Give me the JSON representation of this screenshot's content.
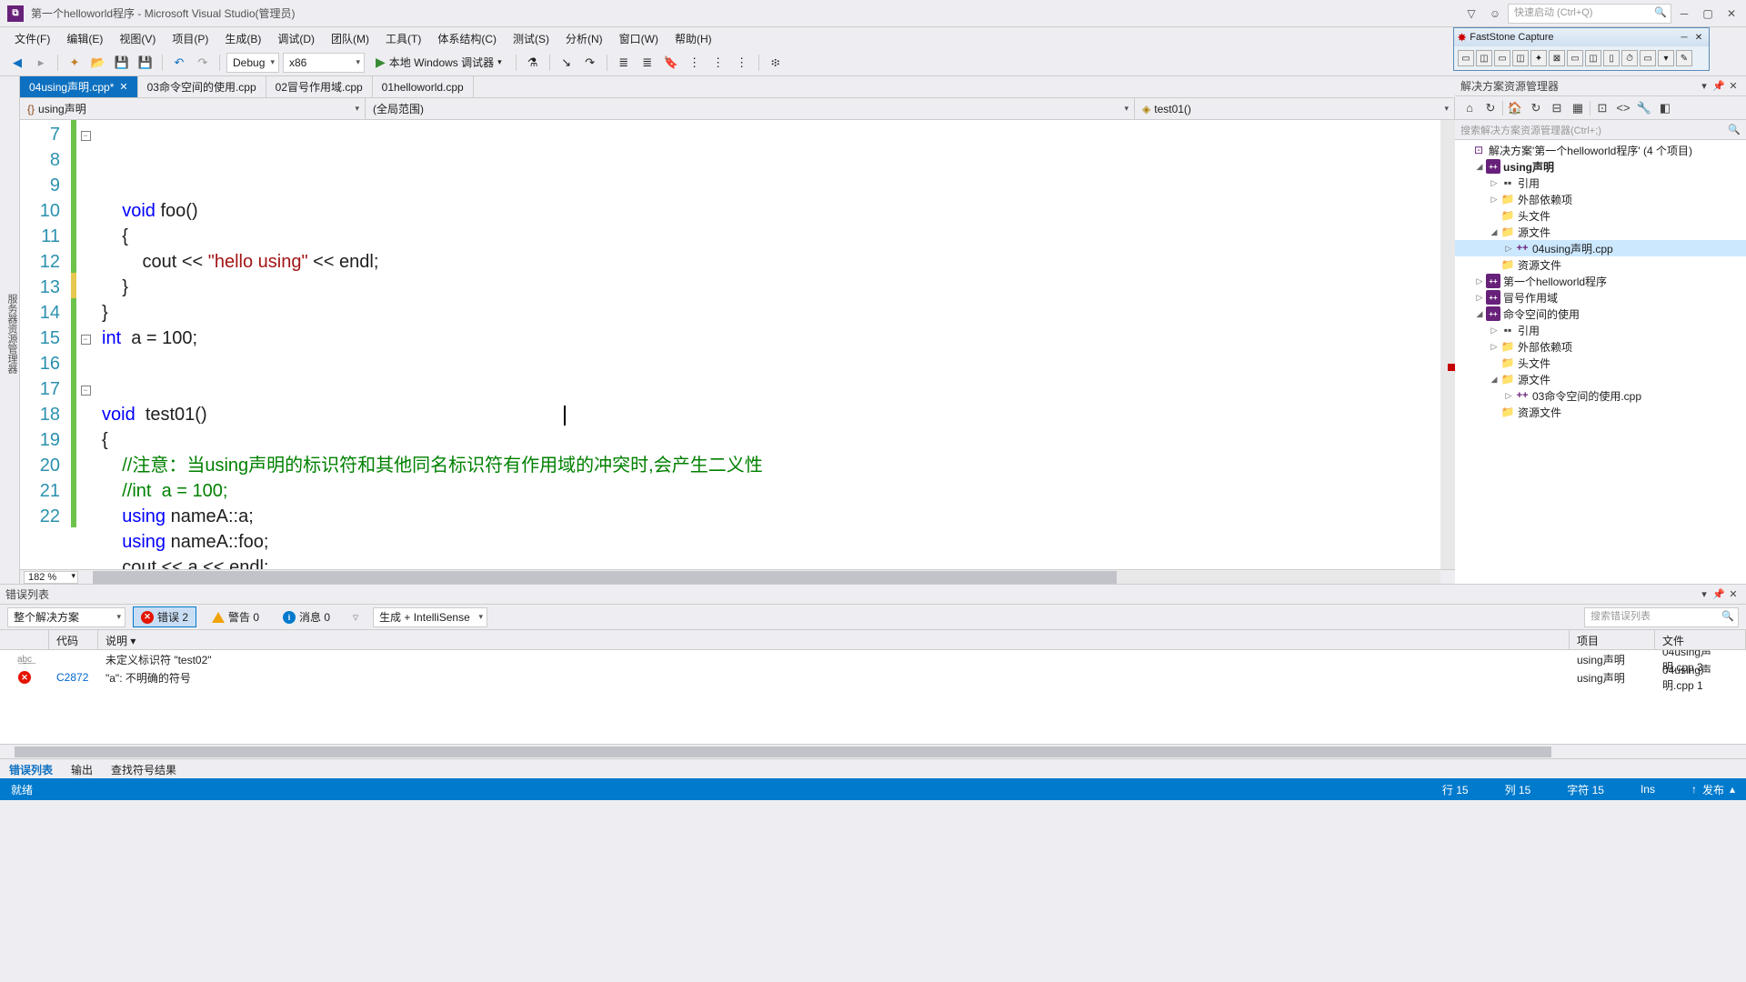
{
  "title": "第一个helloworld程序 - Microsoft Visual Studio(管理员)",
  "quickLaunch": "快速启动 (Ctrl+Q)",
  "menu": [
    "文件(F)",
    "编辑(E)",
    "视图(V)",
    "项目(P)",
    "生成(B)",
    "调试(D)",
    "团队(M)",
    "工具(T)",
    "体系结构(C)",
    "测试(S)",
    "分析(N)",
    "窗口(W)",
    "帮助(H)"
  ],
  "toolbar": {
    "config": "Debug",
    "platform": "x86",
    "startLabel": "本地 Windows 调试器"
  },
  "tabs": [
    {
      "label": "04using声明.cpp*",
      "active": true,
      "closable": true
    },
    {
      "label": "03命令空间的使用.cpp",
      "active": false
    },
    {
      "label": "02冒号作用域.cpp",
      "active": false
    },
    {
      "label": "01helloworld.cpp",
      "active": false
    }
  ],
  "navBar": {
    "left": "using声明",
    "middle": "(全局范围)",
    "right": "test01()"
  },
  "code": {
    "lines": [
      {
        "n": 7,
        "fold": "-",
        "html": "    <span class='kw'>void</span> foo()"
      },
      {
        "n": 8,
        "html": "    {"
      },
      {
        "n": 9,
        "html": "        cout &lt;&lt; <span class='str'>\"hello using\"</span> &lt;&lt; endl;"
      },
      {
        "n": 10,
        "html": "    }"
      },
      {
        "n": 11,
        "html": "}"
      },
      {
        "n": 12,
        "html": "<span class='kw'>int</span>  a = 100;"
      },
      {
        "n": 13,
        "mod": "yellow",
        "html": ""
      },
      {
        "n": 14,
        "html": ""
      },
      {
        "n": 15,
        "fold": "-",
        "html": "<span class='kw'>void</span>  test01()"
      },
      {
        "n": 16,
        "html": "{"
      },
      {
        "n": 17,
        "fold": "-",
        "html": "    <span class='cmt'>//注意：当using声明的标识符和其他同名标识符有作用域的冲突时,会产生二义性</span>"
      },
      {
        "n": 18,
        "html": "    <span class='cmt'>//int  a = 100;</span>"
      },
      {
        "n": 19,
        "html": "    <span class='kw'>using</span> nameA::a;"
      },
      {
        "n": 20,
        "html": "    <span class='kw'>using</span> nameA::foo;"
      },
      {
        "n": 21,
        "html": "    cout &lt;&lt; a &lt;&lt; endl;"
      },
      {
        "n": 22,
        "html": "    cout &lt;&lt; a &lt;&lt; endl;"
      }
    ],
    "zoom": "182 %"
  },
  "solutionExplorer": {
    "title": "解决方案资源管理器",
    "searchPlaceholder": "搜索解决方案资源管理器(Ctrl+;)",
    "root": "解决方案'第一个helloworld程序' (4 个项目)",
    "projects": [
      {
        "name": "using声明",
        "expanded": true,
        "bold": true,
        "children": [
          {
            "name": "引用",
            "icon": "ref",
            "arrow": "▷"
          },
          {
            "name": "外部依赖项",
            "icon": "folder",
            "arrow": "▷"
          },
          {
            "name": "头文件",
            "icon": "folder"
          },
          {
            "name": "源文件",
            "icon": "folder",
            "expanded": true,
            "children": [
              {
                "name": "04using声明.cpp",
                "icon": "cpp",
                "selected": true,
                "arrow": "▷"
              }
            ]
          },
          {
            "name": "资源文件",
            "icon": "folder"
          }
        ]
      },
      {
        "name": "第一个helloworld程序",
        "arrow": "▷"
      },
      {
        "name": "冒号作用域",
        "arrow": "▷"
      },
      {
        "name": "命令空间的使用",
        "expanded": true,
        "children": [
          {
            "name": "引用",
            "icon": "ref",
            "arrow": "▷"
          },
          {
            "name": "外部依赖项",
            "icon": "folder",
            "arrow": "▷"
          },
          {
            "name": "头文件",
            "icon": "folder"
          },
          {
            "name": "源文件",
            "icon": "folder",
            "expanded": true,
            "children": [
              {
                "name": "03命令空间的使用.cpp",
                "icon": "cpp",
                "arrow": "▷"
              }
            ]
          },
          {
            "name": "资源文件",
            "icon": "folder"
          }
        ]
      }
    ]
  },
  "errorList": {
    "title": "错误列表",
    "scope": "整个解决方案",
    "errCount": "错误 2",
    "warnCount": "警告 0",
    "infoCount": "消息 0",
    "buildFilter": "生成 + IntelliSense",
    "searchPlaceholder": "搜索错误列表",
    "columns": [
      "",
      "代码",
      "说明",
      "项目",
      "文件"
    ],
    "rows": [
      {
        "icon": "abc",
        "code": "",
        "desc": "未定义标识符 \"test02\"",
        "proj": "using声明",
        "file": "04using声明.cpp 3"
      },
      {
        "icon": "err",
        "code": "C2872",
        "desc": "\"a\": 不明确的符号",
        "proj": "using声明",
        "file": "04using声明.cpp 1"
      }
    ]
  },
  "outputTabs": [
    "错误列表",
    "输出",
    "查找符号结果"
  ],
  "statusBar": {
    "ready": "就绪",
    "line": "行 15",
    "col": "列 15",
    "char": "字符 15",
    "ins": "Ins",
    "publish": "发布"
  },
  "faststone": {
    "title": "FastStone Capture"
  }
}
